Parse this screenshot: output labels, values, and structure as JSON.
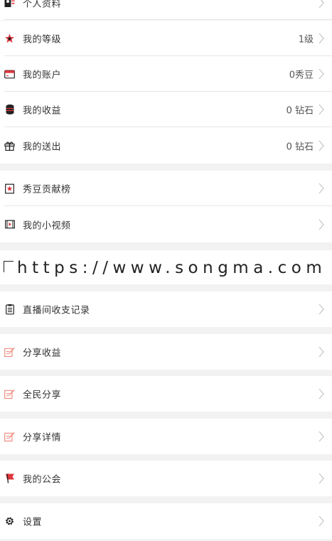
{
  "menu": {
    "group1": [
      {
        "label": "个人资料",
        "value": "",
        "icon": "profile-card-icon"
      },
      {
        "label": "我的等级",
        "value": "1级",
        "icon": "level-badge-icon"
      },
      {
        "label": "我的账户",
        "value": "0秀豆",
        "icon": "account-card-icon"
      },
      {
        "label": "我的收益",
        "value": "0 钻石",
        "icon": "coin-stack-icon"
      },
      {
        "label": "我的送出",
        "value": "0 钻石",
        "icon": "gift-icon"
      }
    ],
    "group2": [
      {
        "label": "秀豆贡献榜",
        "value": "",
        "icon": "rank-board-icon"
      },
      {
        "label": "我的小视频",
        "value": "",
        "icon": "video-icon"
      }
    ],
    "watermark": "https://www.songma.com",
    "group3": [
      {
        "label": "直播间收支记录",
        "value": "",
        "icon": "record-clipboard-icon"
      },
      {
        "label": "分享收益",
        "value": "",
        "icon": "share-edit-icon"
      },
      {
        "label": "全民分享",
        "value": "",
        "icon": "share-edit-icon"
      },
      {
        "label": "分享详情",
        "value": "",
        "icon": "share-edit-icon"
      },
      {
        "label": "我的公会",
        "value": "",
        "icon": "red-flag-icon"
      },
      {
        "label": "设置",
        "value": "",
        "icon": "gear-icon"
      }
    ]
  },
  "colors": {
    "background": "#f2f2f2",
    "row": "#ffffff",
    "divider": "#e6e6e6",
    "accent_red": "#e0353b",
    "share_icon": "#f08a7a",
    "chevron": "#c8c8c8"
  }
}
